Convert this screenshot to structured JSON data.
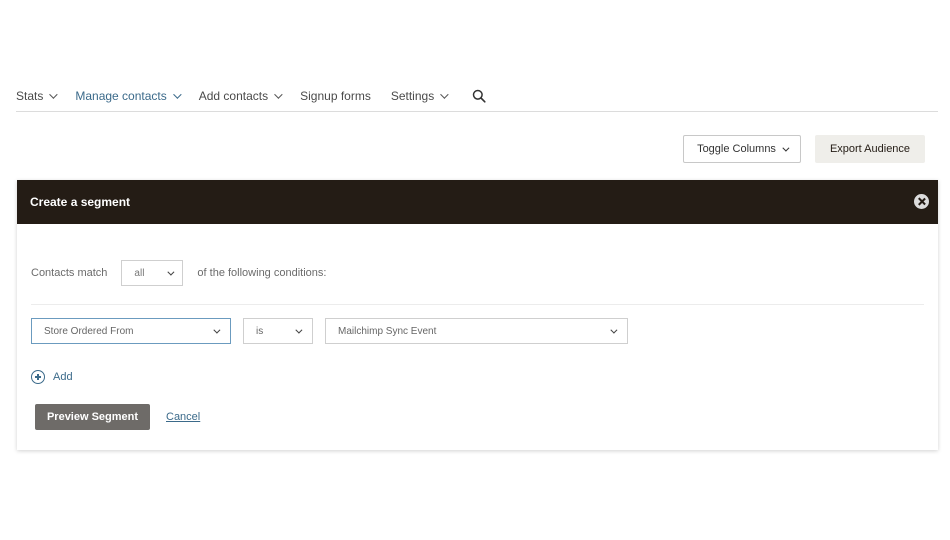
{
  "nav": {
    "items": [
      {
        "label": "Stats",
        "has_dropdown": true
      },
      {
        "label": "Manage contacts",
        "has_dropdown": true,
        "active": true
      },
      {
        "label": "Add contacts",
        "has_dropdown": true
      },
      {
        "label": "Signup forms",
        "has_dropdown": false
      },
      {
        "label": "Settings",
        "has_dropdown": true
      }
    ],
    "search_icon": "search-icon"
  },
  "actions": {
    "toggle_columns": "Toggle Columns",
    "export_audience": "Export Audience"
  },
  "segment": {
    "title": "Create a segment",
    "match_prefix": "Contacts match",
    "match_value": "all",
    "match_suffix": "of the following conditions:",
    "condition": {
      "field": "Store Ordered From",
      "operator": "is",
      "value": "Mailchimp Sync Event"
    },
    "add_label": "Add",
    "preview_button": "Preview Segment",
    "cancel_link": "Cancel"
  },
  "colors": {
    "header_bg": "#241c15",
    "link": "#3b6a8a",
    "preview_bg": "#6e6b68",
    "export_bg": "#efeeea"
  }
}
